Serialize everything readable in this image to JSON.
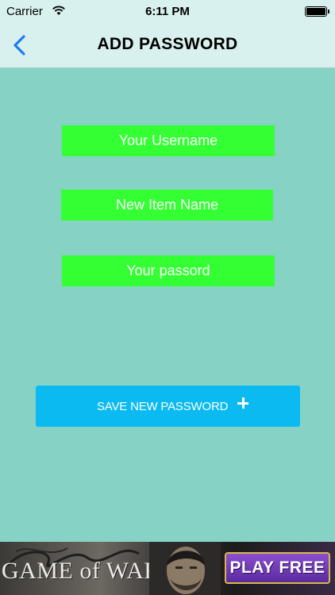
{
  "status_bar": {
    "carrier": "Carrier",
    "time": "6:11 PM"
  },
  "nav": {
    "title": "ADD PASSWORD",
    "back_icon": "chevron-left-icon"
  },
  "form": {
    "username_placeholder": "Your Username",
    "item_name_placeholder": "New Item Name",
    "password_placeholder": "Your passord"
  },
  "save_button": {
    "label": "SAVE NEW PASSWORD",
    "icon": "plus-icon"
  },
  "ad": {
    "logo": "GAME of WAR",
    "cta": "PLAY FREE"
  },
  "colors": {
    "background": "#86d3c5",
    "bar": "#d9f1ee",
    "field": "#33ff33",
    "button": "#0abaf0",
    "accent": "#1c7cf3"
  }
}
